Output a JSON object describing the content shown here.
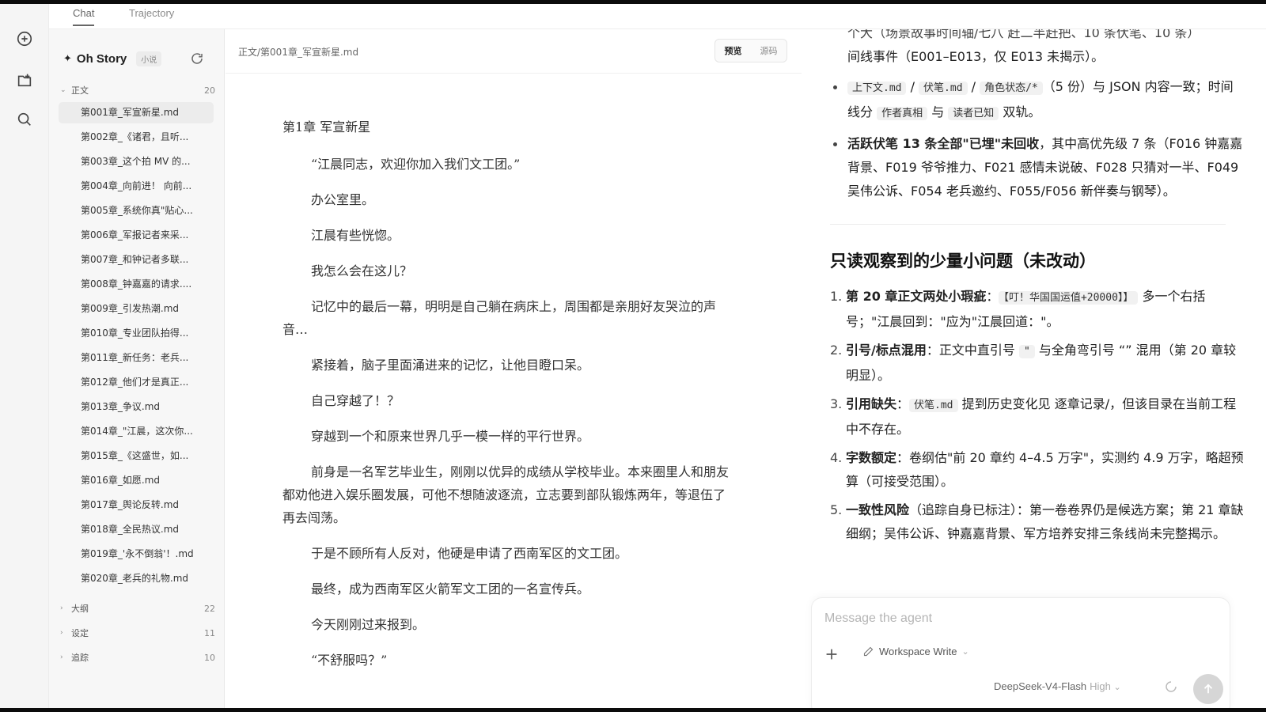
{
  "tabs": {
    "chat": "Chat",
    "trajectory": "Trajectory"
  },
  "sidebar": {
    "brand": "Oh Story",
    "badge": "小说",
    "folders": {
      "main": {
        "label": "正文",
        "count": "20"
      },
      "outline": {
        "label": "大纲",
        "count": "22"
      },
      "settings": {
        "label": "设定",
        "count": "11"
      },
      "tracking": {
        "label": "追踪",
        "count": "10"
      }
    },
    "files": [
      "第001章_军宣新星.md",
      "第002章_《诸君，且听...",
      "第003章_这个拍 MV 的...",
      "第004章_向前进！ 向前...",
      "第005章_系统你真\"贴心...",
      "第006章_军报记者来采...",
      "第007章_和钟记者多联...",
      "第008章_钟嘉嘉的请求....",
      "第009章_引发热潮.md",
      "第010章_专业团队拍得...",
      "第011章_新任务：老兵...",
      "第012章_他们才是真正...",
      "第013章_争议.md",
      "第014章_\"江晨，这次你...",
      "第015章_《这盛世，如...",
      "第016章_如愿.md",
      "第017章_舆论反转.md",
      "第018章_全民热议.md",
      "第019章_'永不倒翁'！.md",
      "第020章_老兵的礼物.md"
    ]
  },
  "editor": {
    "path": "正文/第001章_军宣新星.md",
    "preview_label": "预览",
    "source_label": "源码",
    "chapter_title": "第1章 军宣新星",
    "paragraphs": [
      "“江晨同志，欢迎你加入我们文工团。”",
      "办公室里。",
      "江晨有些恍惚。",
      "我怎么会在这儿？",
      "记忆中的最后一幕，明明是自己躺在病床上，周围都是亲朋好友哭泣的声音…",
      "紧接着，脑子里面涌进来的记忆，让他目瞪口呆。",
      "自己穿越了！？",
      "穿越到一个和原来世界几乎一模一样的平行世界。",
      "前身是一名军艺毕业生，刚刚以优异的成绩从学校毕业。本来圈里人和朋友都劝他进入娱乐圈发展，可他不想随波逐流，立志要到部队锻炼两年，等退伍了再去闯荡。",
      "于是不顾所有人反对，他硬是申请了西南军区的文工团。",
      "最终，成为西南军区火箭军文工团的一名宣传兵。",
      "今天刚刚过来报到。",
      "“不舒服吗？”"
    ]
  },
  "agent": {
    "top_line_1": "个大（场景故事时间轴/七八 赶二半赶把、10 条伏笔、10 条）",
    "top_line_2": "间线事件（E001–E013，仅 E013 未揭示）。",
    "bullet1": {
      "code1": "上下文.md",
      "sep1": " / ",
      "code2": "伏笔.md",
      "sep2": " / ",
      "code3": "角色状态/*",
      "text1": "（5 份）与 JSON 内容一致；时间线分 ",
      "code4": "作者真相",
      "text2": " 与 ",
      "code5": "读者已知",
      "text3": " 双轨。"
    },
    "bullet2": {
      "strong": "活跃伏笔 13 条全部\"已埋\"未回收",
      "text": "，其中高优先级 7 条（F016 钟嘉嘉背景、F019 爷爷推力、F021 感情未说破、F028 只猜对一半、F049 吴伟公诉、F054 老兵邀约、F055/F056 新伴奏与钢琴）。"
    },
    "issues_heading": "只读观察到的少量小问题（未改动）",
    "issues": [
      {
        "num": "1.",
        "strong": "第 20 章正文两处小瑕疵",
        "pre": "：",
        "code": "【叮！华国国运值+20000】】",
        "text": " 多一个右括号；\"江晨回到：\"应为\"江晨回道：\"。"
      },
      {
        "num": "2.",
        "strong": "引号/标点混用",
        "pre": "：正文中直引号 ",
        "code": "\"",
        "text": " 与全角弯引号 “” 混用（第 20 章较明显）。"
      },
      {
        "num": "3.",
        "strong": "引用缺失",
        "pre": "：",
        "code": "伏笔.md",
        "text": " 提到历史变化见 逐章记录/，但该目录在当前工程中不存在。"
      },
      {
        "num": "4.",
        "strong": "字数额定",
        "pre": "：卷纲估\"前 20 章约 4–4.5 万字\"，实测约 4.9 万字，略超预算（可接受范围）。",
        "code": "",
        "text": ""
      },
      {
        "num": "5.",
        "strong": "一致性风险",
        "pre": "（追踪自身已标注）：第一卷卷界仍是候选方案；第 21 章缺细纲；吴伟公诉、钟嘉嘉背景、军方培养安排三条线尚未完整揭示。",
        "code": "",
        "text": ""
      }
    ],
    "composer": {
      "placeholder": "Message the agent",
      "workspace": "Workspace Write",
      "model": "DeepSeek-V4-Flash",
      "level": "High"
    }
  }
}
